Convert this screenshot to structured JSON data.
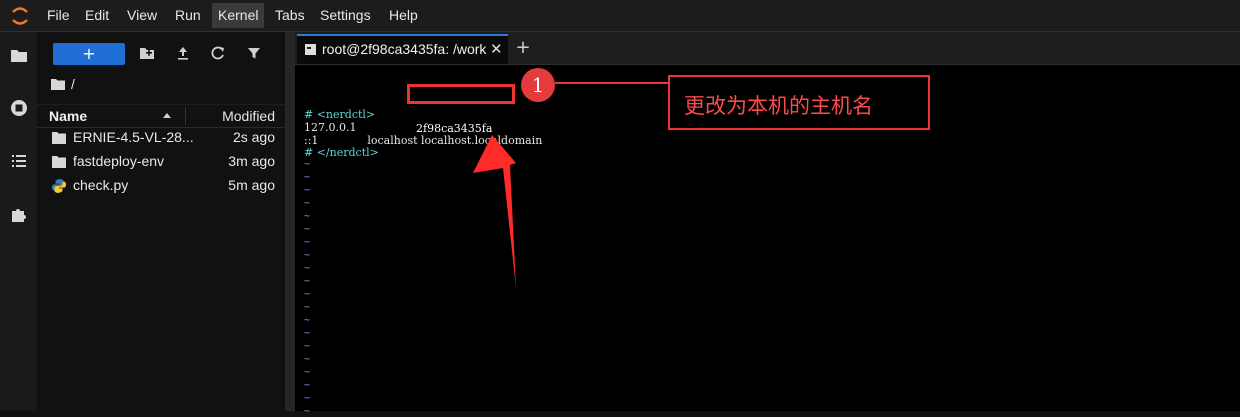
{
  "menubar": {
    "items": [
      "File",
      "Edit",
      "View",
      "Run",
      "Kernel",
      "Tabs",
      "Settings",
      "Help"
    ],
    "active": "Kernel"
  },
  "filebrowser": {
    "new_label": "+",
    "breadcrumb": "/",
    "header": {
      "name": "Name",
      "modified": "Modified"
    },
    "files": [
      {
        "name": "ERNIE-4.5-VL-28...",
        "modified": "2s ago",
        "icon": "folder-icon"
      },
      {
        "name": "fastdeploy-env",
        "modified": "3m ago",
        "icon": "folder-icon"
      },
      {
        "name": "check.py",
        "modified": "5m ago",
        "icon": "python-icon"
      }
    ]
  },
  "tabs": {
    "terminal_label": "root@2f98ca3435fa: /work",
    "close": "✕",
    "add": "+"
  },
  "terminal": {
    "lines": {
      "open_comment": "# <nerdctl>",
      "ipv4_addr": "127.0.0.1",
      "hostname": "2f98ca3435fa",
      "ipv6_line": "::1              localhost localhost.localdomain",
      "close_comment": "# </nerdctl>"
    },
    "tilde": "~"
  },
  "annotation": {
    "badge": "1",
    "callout": "更改为本机的主机名",
    "color": "#e33333"
  }
}
